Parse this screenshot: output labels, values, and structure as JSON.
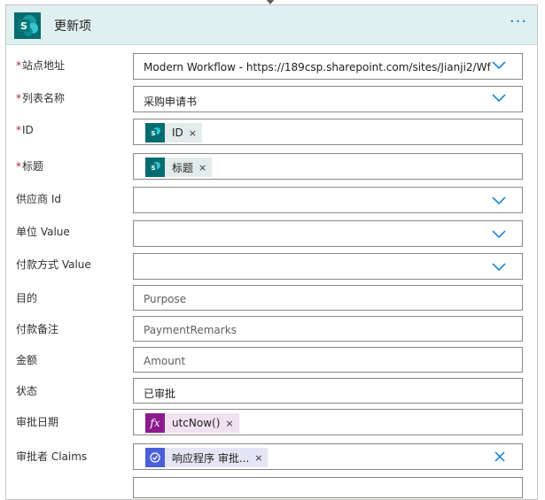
{
  "action": {
    "title": "更新项",
    "more_label": "···"
  },
  "icons": {
    "connector": "sharepoint-icon",
    "more": "more-options-icon",
    "dropdown": "chevron-down-icon",
    "expression": "function-icon",
    "approvals": "approvals-icon",
    "clear": "close-icon"
  },
  "colors": {
    "header_bg": "#e0eff0",
    "sharepoint": "#036c70",
    "expression": "#8c1a8c",
    "approvals": "#4a5fd9",
    "accent": "#0078d4",
    "required": "#a4262c"
  },
  "fields": {
    "site": {
      "required": "*",
      "label": "站点地址",
      "value": "Modern Workflow - https://189csp.sharepoint.com/sites/Jianji2/Wf"
    },
    "list": {
      "required": "*",
      "label": "列表名称",
      "value": "采购申请书"
    },
    "id": {
      "required": "*",
      "label": "ID",
      "token": "ID",
      "token_remove": "×"
    },
    "title": {
      "required": "*",
      "label": "标题",
      "token": "标题",
      "token_remove": "×"
    },
    "supplier": {
      "label": "供应商 Id",
      "value": ""
    },
    "unit": {
      "label": "单位 Value",
      "value": ""
    },
    "payment_method": {
      "label": "付款方式 Value",
      "value": ""
    },
    "purpose": {
      "label": "目的",
      "placeholder": "Purpose"
    },
    "payment_remarks": {
      "label": "付款备注",
      "placeholder": "PaymentRemarks"
    },
    "amount": {
      "label": "金额",
      "placeholder": "Amount"
    },
    "status": {
      "label": "状态",
      "value": "已审批"
    },
    "approval_date": {
      "label": "审批日期",
      "token": "utcNow()",
      "token_remove": "×",
      "fx_glyph": "fx"
    },
    "approver_claims": {
      "label": "审批者 Claims",
      "token": "响应程序 审批...",
      "token_remove": "×"
    }
  }
}
